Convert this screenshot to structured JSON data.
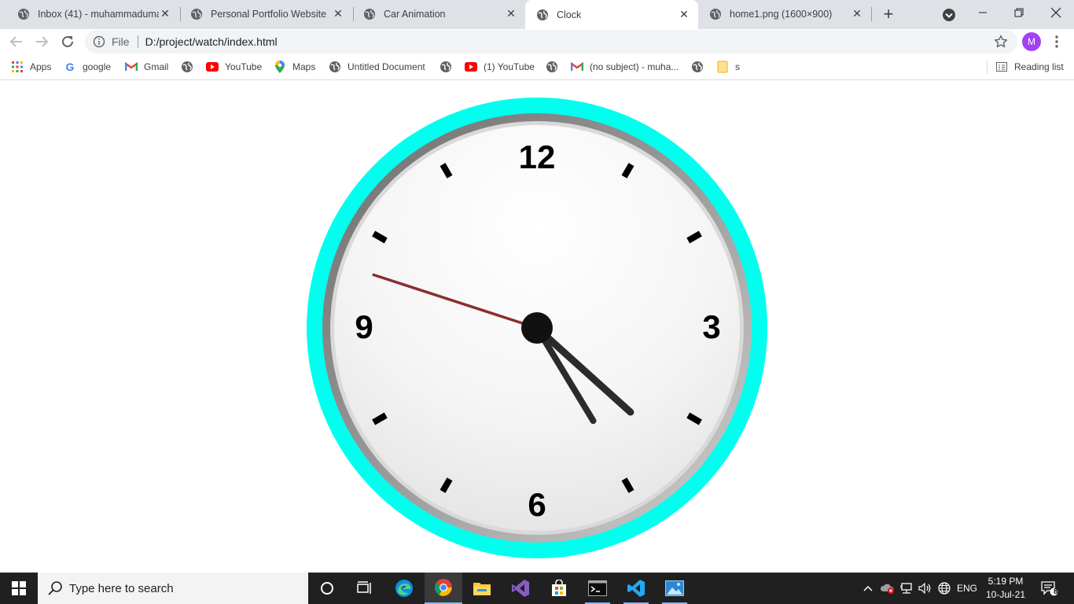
{
  "browser": {
    "tabs": [
      {
        "title": "Inbox (41) - muhammaduma…",
        "icon": "globe-icon",
        "active": false
      },
      {
        "title": "Personal Portfolio Website",
        "icon": "globe-icon",
        "active": false
      },
      {
        "title": "Car Animation",
        "icon": "globe-icon",
        "active": false
      },
      {
        "title": "Clock",
        "icon": "globe-icon",
        "active": true
      },
      {
        "title": "home1.png (1600×900)",
        "icon": "globe-icon",
        "active": false
      }
    ],
    "address": {
      "scheme_label": "File",
      "url": "D:/project/watch/index.html"
    },
    "profile_initial": "M",
    "bookmarks": [
      {
        "label": "Apps",
        "icon": "apps-grid-icon"
      },
      {
        "label": "google",
        "icon": "google-icon"
      },
      {
        "label": "Gmail",
        "icon": "gmail-icon"
      },
      {
        "label": "",
        "icon": "globe-icon"
      },
      {
        "label": "YouTube",
        "icon": "youtube-icon"
      },
      {
        "label": "Maps",
        "icon": "maps-icon"
      },
      {
        "label": "Untitled Document",
        "icon": "globe-icon"
      },
      {
        "label": "",
        "icon": "globe-icon"
      },
      {
        "label": "(1) YouTube",
        "icon": "youtube-icon"
      },
      {
        "label": "",
        "icon": "globe-icon"
      },
      {
        "label": "(no subject) - muha...",
        "icon": "gmail-icon"
      },
      {
        "label": "",
        "icon": "globe-icon"
      },
      {
        "label": "s",
        "icon": "folder-icon"
      }
    ],
    "reading_list_label": "Reading list"
  },
  "clock": {
    "numerals": [
      "12",
      "3",
      "6",
      "9"
    ],
    "time": {
      "hours": 4,
      "minutes": 24,
      "seconds": 48
    },
    "colors": {
      "rim": "#00ffee",
      "second_hand": "#8b2e2e",
      "hands": "#2b2b2b"
    }
  },
  "taskbar": {
    "search_placeholder": "Type here to search",
    "language": "ENG",
    "time": "5:19 PM",
    "date": "10-Jul-21",
    "notification_count": "8"
  }
}
